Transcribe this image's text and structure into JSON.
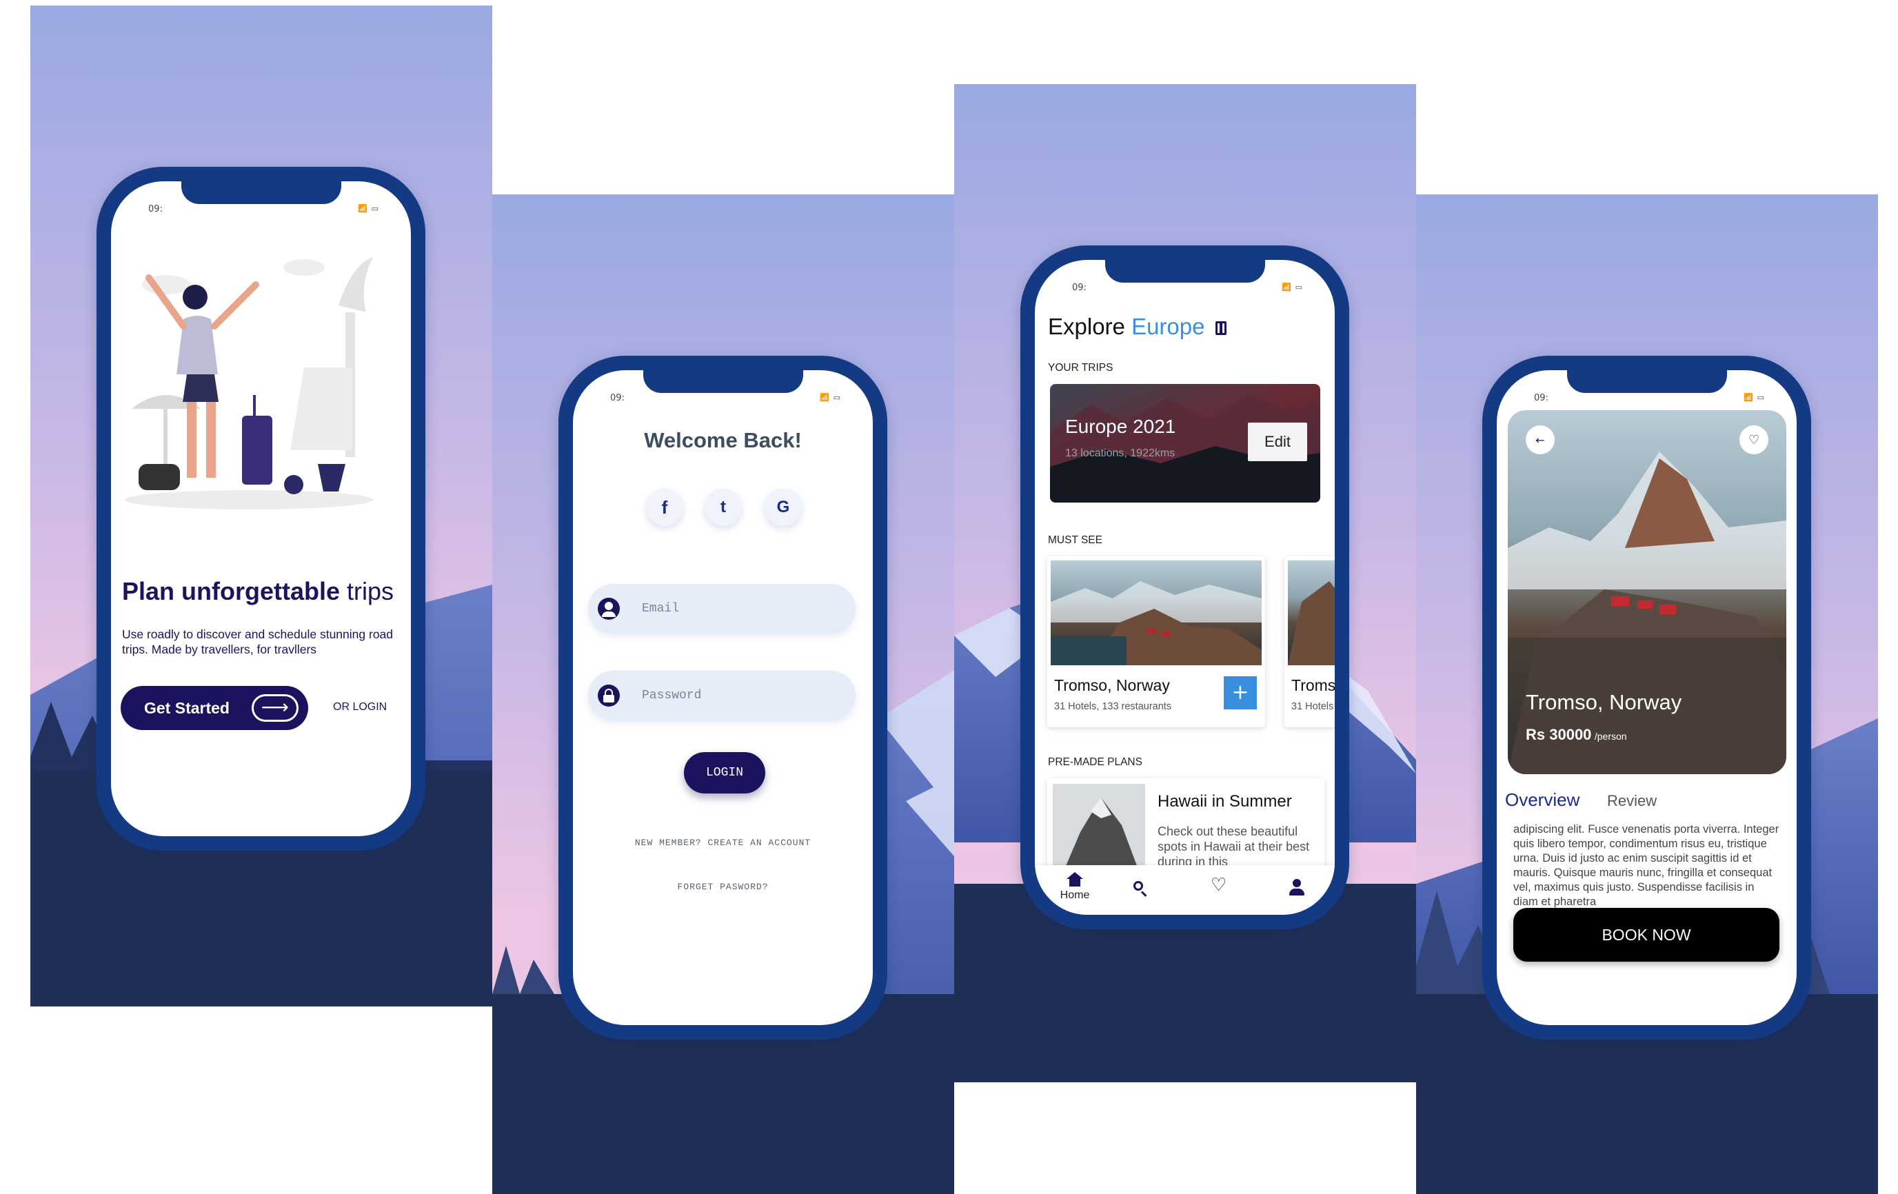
{
  "status_bar": {
    "time": "09:",
    "icons": "📶 ▭"
  },
  "screen1": {
    "headline_bold": "Plan unforgettable",
    "headline_light": "trips",
    "description": "Use roadly to discover and schedule stunning road trips. Made by travellers, for travllers",
    "cta_label": "Get Started",
    "cta_arrow": "⟶",
    "login_link": "OR LOGIN"
  },
  "screen2": {
    "title": "Welcome Back!",
    "social": {
      "facebook": "f",
      "twitter": "t",
      "google": "G"
    },
    "email_placeholder": "Email",
    "password_placeholder": "Password",
    "login_label": "LOGIN",
    "signup_text": "NEW MEMBER? CREATE AN ACCOUNT",
    "forgot_text": "FORGET PASWORD?"
  },
  "screen3": {
    "title_main": "Explore",
    "title_accent": "Europe",
    "your_trips_heading": "YOUR TRIPS",
    "trip": {
      "name": "Europe 2021",
      "meta": "13 locations, 1922kms",
      "edit_label": "Edit"
    },
    "must_see_heading": "MUST SEE",
    "must_see": [
      {
        "name": "Tromso, Norway",
        "meta": "31 Hotels, 133 restaurants",
        "add_label": "+"
      },
      {
        "name": "Tromso",
        "meta": "31 Hotels"
      }
    ],
    "plans_heading": "PRE-MADE PLANS",
    "plan": {
      "title": "Hawaii in Summer",
      "desc": "Check out these beautiful spots in Hawaii at their best during in this"
    },
    "nav": {
      "home_label": "Home"
    }
  },
  "screen4": {
    "place": "Tromso, Norway",
    "price": "Rs 30000",
    "price_unit": "/person",
    "tab_overview": "Overview",
    "tab_review": "Review",
    "body": "adipiscing elit. Fusce venenatis porta viverra. Integer quis libero tempor, condimentum risus eu, tristique urna. Duis id justo ac enim suscipit sagittis id et mauris. Quisque mauris nunc, fringilla et consequat vel, maximus quis justo. Suspendisse facilisis in diam et pharetra",
    "book_label": "BOOK NOW"
  },
  "colors": {
    "navy": "#1a145e",
    "frame": "#143a84",
    "accent_blue": "#3a8ee0",
    "sky_top": "#9aa9e2",
    "sky_bottom": "#eac7e4",
    "ground": "#1f2f57"
  }
}
